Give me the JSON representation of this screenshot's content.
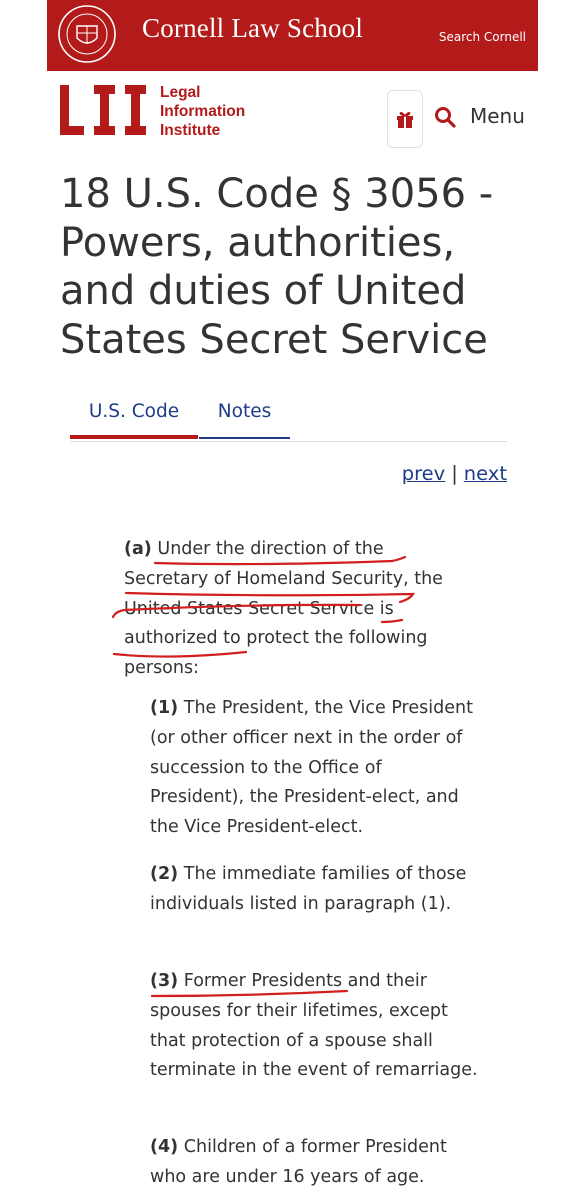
{
  "header": {
    "title": "Cornell Law School",
    "search_link": "Search Cornell"
  },
  "lii": {
    "logo_letters": "LII",
    "logo_words": [
      "Legal",
      "Information",
      "Institute"
    ],
    "menu_label": "Menu"
  },
  "page": {
    "title": "18 U.S. Code § 3056 - Powers, authorities, and duties of United States Secret Service"
  },
  "tabs": [
    {
      "label": "U.S. Code",
      "active": true
    },
    {
      "label": "Notes",
      "active": false
    }
  ],
  "pager": {
    "prev": "prev",
    "separator": "|",
    "next": "next"
  },
  "statute": {
    "a": {
      "num": "(a)",
      "text": "Under the direction of the Secretary of Homeland Security, the United States Secret Service is authorized to protect the following persons:"
    },
    "items": [
      {
        "num": "(1)",
        "text": "The President, the Vice President (or other officer next in the order of succession to the Office of President), the President-elect, and the Vice President-elect."
      },
      {
        "num": "(2)",
        "text": "The immediate families of those individuals listed in paragraph (1)."
      },
      {
        "num": "(3)",
        "text": "Former Presidents and their spouses for their lifetimes, except that protection of a spouse shall terminate in the event of remarriage."
      },
      {
        "num": "(4)",
        "text": "Children of a former President who are under 16 years of age."
      }
    ]
  },
  "colors": {
    "brand_red": "#b31b1b",
    "link_blue": "#1f3c88",
    "annotation_red": "#d21e1e"
  }
}
